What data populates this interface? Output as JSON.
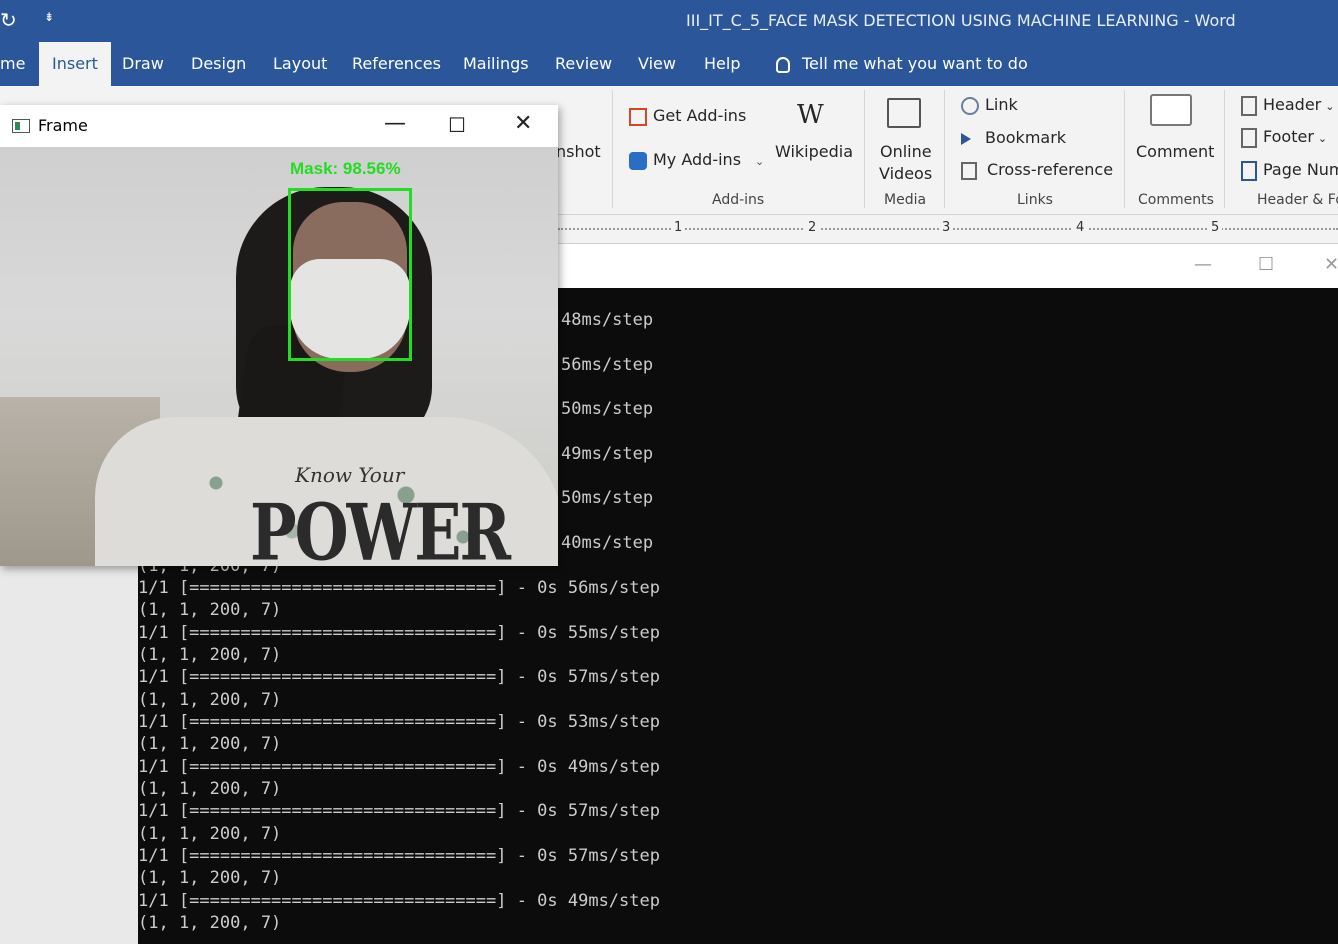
{
  "word": {
    "quick_access": {
      "redo_icon": "↻",
      "customize": "⇟"
    },
    "title": "III_IT_C_5_FACE MASK DETECTION USING MACHINE LEARNING  -  Word",
    "tabs": [
      "me",
      "Insert",
      "Draw",
      "Design",
      "Layout",
      "References",
      "Mailings",
      "Review",
      "View",
      "Help"
    ],
    "active_tab": "Insert",
    "tell_me": "Tell me what you want to do",
    "ribbon": {
      "screenshot_partial": "nshot",
      "get_addins": "Get Add-ins",
      "my_addins": "My Add-ins",
      "wikipedia": "Wikipedia",
      "addins_group": "Add-ins",
      "online_videos_1": "Online",
      "online_videos_2": "Videos",
      "media_group": "Media",
      "link": "Link",
      "bookmark": "Bookmark",
      "cross_reference": "Cross-reference",
      "links_group": "Links",
      "comment": "Comment",
      "comments_group": "Comments",
      "header": "Header",
      "footer": "Footer",
      "page_number": "Page Num",
      "header_footer_group": "Header & Fo"
    },
    "ruler_numbers": [
      "1",
      "2",
      "3",
      "4",
      "5"
    ],
    "colors": {
      "title_bar": "#2b579a",
      "ribbon": "#f3f3f3"
    }
  },
  "frame_window": {
    "title": "Frame",
    "minimize": "—",
    "maximize": "☐",
    "close": "✕",
    "detection_label": "Mask: 98.56%",
    "detection_color": "#22dd22",
    "shirt_text": "POWER",
    "shirt_script": "Know Your"
  },
  "console": {
    "window_controls": {
      "minimize": "—",
      "maximize": "☐",
      "close": "✕"
    },
    "partial_lines": [
      "48ms/step",
      "56ms/step",
      "50ms/step",
      "49ms/step",
      "50ms/step",
      "40ms/step"
    ],
    "clipped_line": "(1, 1, 200, 7)",
    "lines": [
      "1/1 [==============================] - 0s 56ms/step",
      "(1, 1, 200, 7)",
      "1/1 [==============================] - 0s 55ms/step",
      "(1, 1, 200, 7)",
      "1/1 [==============================] - 0s 57ms/step",
      "(1, 1, 200, 7)",
      "1/1 [==============================] - 0s 53ms/step",
      "(1, 1, 200, 7)",
      "1/1 [==============================] - 0s 49ms/step",
      "(1, 1, 200, 7)",
      "1/1 [==============================] - 0s 57ms/step",
      "(1, 1, 200, 7)",
      "1/1 [==============================] - 0s 57ms/step",
      "(1, 1, 200, 7)",
      "1/1 [==============================] - 0s 49ms/step",
      "(1, 1, 200, 7)"
    ]
  }
}
